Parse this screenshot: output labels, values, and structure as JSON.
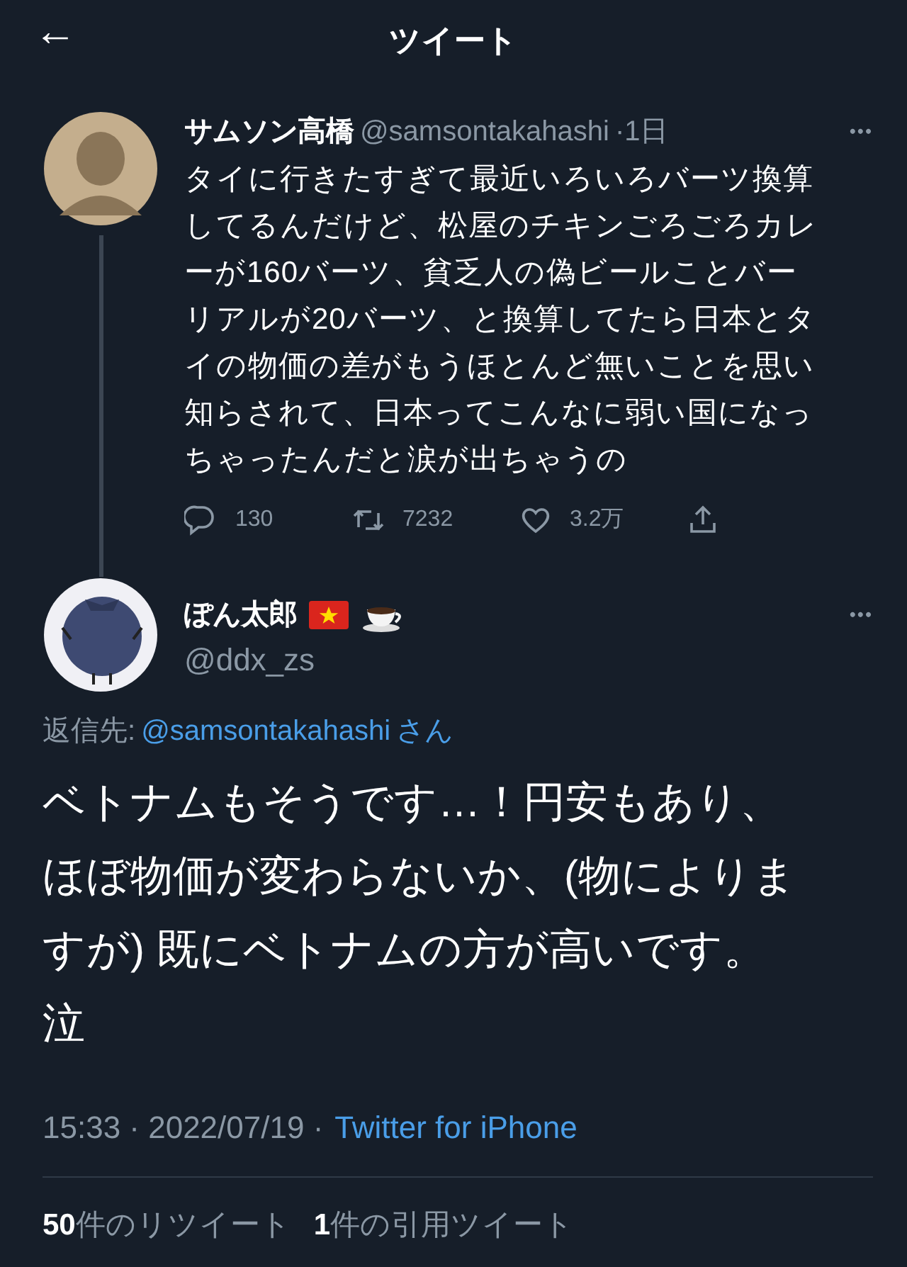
{
  "header": {
    "back": "←",
    "title": "ツイート"
  },
  "parent_tweet": {
    "name": "サムソン高橋",
    "handle": "@samsontakahashi",
    "time": "·1日",
    "more": "•••",
    "lines": [
      "タイに行きたすぎて最近いろいろバーツ換算",
      "してるんだけど、松屋のチキンごろごろカレ",
      "ーが160バーツ、貧乏人の偽ビールことバー",
      "リアルが20バーツ、と換算してたら日本とタ",
      "イの物価の差がもうほとんど無いことを思い",
      "知らされて、日本ってこんなに弱い国になっ",
      "ちゃったんだと涙が出ちゃうの"
    ],
    "actions": [
      {
        "kind": "reply",
        "count": "130"
      },
      {
        "kind": "retweet",
        "count": "7232"
      },
      {
        "kind": "like",
        "count": "3.2万"
      },
      {
        "kind": "share"
      }
    ]
  },
  "tweet": {
    "name": "ぽん太郎",
    "handle": "@ddx_zs",
    "more": "•••",
    "reply_to_label": "返信先:",
    "reply_to_handle": "@samsontakahashi",
    "reply_to_suffix": "さん",
    "lines": [
      "ベトナムもそうです…！円安もあり、",
      "ほぼ物価が変わらないか、(物によりま",
      "すが) 既にベトナムの方が高いです。",
      "泣"
    ],
    "time": "15:33 · 2022/07/19 ·",
    "source": "Twitter for iPhone"
  },
  "stats": [
    {
      "count": "50",
      "label": "件のリツイート"
    },
    {
      "count": "1",
      "label": "件の引用ツイート"
    }
  ]
}
